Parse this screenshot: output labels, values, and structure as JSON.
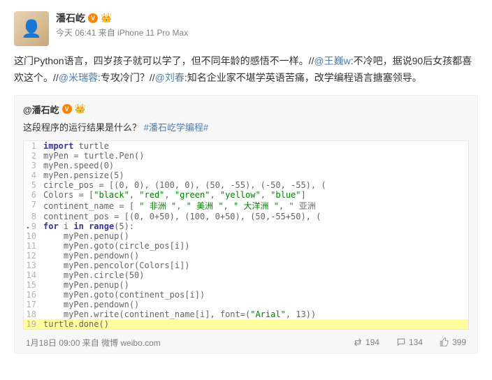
{
  "post": {
    "author": "潘石屹",
    "verified": true,
    "time_source": "今天 06:41 来自 iPhone 11 Pro Max",
    "content_parts": {
      "p1": "这门Python语言，四岁孩子就可以学了，但不同年龄的感悟不一样。",
      "sep1": "//",
      "m1": "@王巍w",
      "r1": ":不冷吧，据说90后女孩都喜欢这个。",
      "sep2": "//",
      "m2": "@米瑞蓉",
      "r2": ":专攻冷门？",
      "sep3": "//",
      "m3": "@刘春",
      "r3": ":知名企业家不堪学英语苦痛，改学编程语言搪塞领导。"
    }
  },
  "quote": {
    "author": "@潘石屹",
    "verified": true,
    "text": "这段程序的运行结果是什么？",
    "hashtag": "#潘石屹学编程#"
  },
  "code": {
    "lines": [
      "import turtle",
      "myPen = turtle.Pen()",
      "myPen.speed(0)",
      "myPen.pensize(5)",
      "circle_pos = [(0, 0), (100, 0), (50, -55), (-50, -55), (",
      "Colors = [\"black\", \"red\", \"green\", \"yellow\", \"blue\"]",
      "continent_name = [ \" 非洲 \", \" 美洲 \", \" 大洋洲 \", \" 亚洲",
      "continent_pos = [(0, 0+50), (100, 0+50), (50,-55+50), (",
      "for i in range(5):",
      "    myPen.penup()",
      "    myPen.goto(circle_pos[i])",
      "    myPen.pendown()",
      "    myPen.pencolor(Colors[i])",
      "    myPen.circle(50)",
      "    myPen.penup()",
      "    myPen.goto(continent_pos[i])",
      "    myPen.pendown()",
      "    myPen.write(continent_name[i], font=(\"Arial\", 13))",
      "turtle.done()"
    ]
  },
  "footer": {
    "time_source": "1月18日 09:00 来自 微博 weibo.com",
    "repost_count": "194",
    "comment_count": "134",
    "like_count": "399"
  }
}
